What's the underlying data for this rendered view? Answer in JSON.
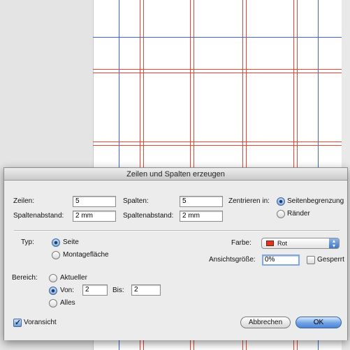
{
  "dialog": {
    "title": "Zeilen und Spalten erzeugen",
    "rows_label": "Zeilen:",
    "rows_value": "5",
    "row_gap_label": "Spaltenabstand:",
    "row_gap_value": "2 mm",
    "columns_label": "Spalten:",
    "columns_value": "5",
    "column_gap_label": "Spaltenabstand:",
    "column_gap_value": "2 mm",
    "center_label": "Zentrieren in:",
    "center_options": [
      "Seitenbegrenzung",
      "Ränder"
    ],
    "center_selected": "Seitenbegrenzung",
    "type_label": "Typ:",
    "type_options": [
      "Seite",
      "Montagefläche"
    ],
    "type_selected": "Seite",
    "color_label": "Farbe:",
    "color_value": "Rot",
    "color_swatch": "#e2341c",
    "view_size_label": "Ansichtsgröße:",
    "view_size_value": "0%",
    "locked_label": "Gesperrt",
    "locked_checked": false,
    "range_label": "Bereich:",
    "range_current": "Aktueller",
    "range_from": "Von:",
    "range_from_value": "2",
    "range_to": "Bis:",
    "range_to_value": "2",
    "range_all": "Alles",
    "range_selected": "Von",
    "preview_label": "Voransicht",
    "preview_checked": true,
    "cancel_label": "Abbrechen",
    "ok_label": "OK"
  },
  "colors": {
    "guide_red": "#e8442f",
    "guide_blue": "#3f63d6",
    "accent_blue": "#4d86d6"
  }
}
